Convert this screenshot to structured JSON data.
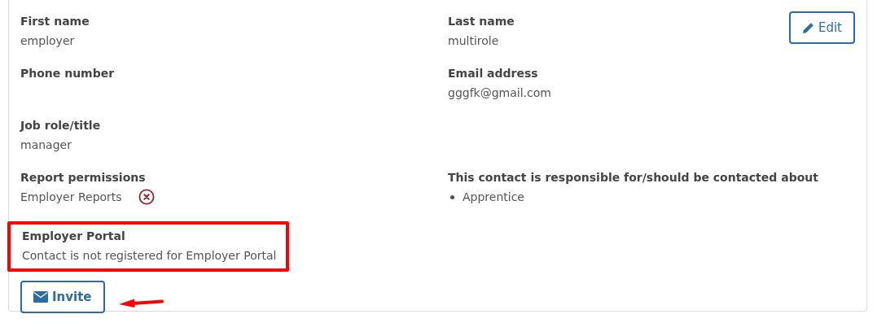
{
  "edit_button": {
    "label": "Edit"
  },
  "rows": [
    {
      "left": {
        "kind": "text",
        "label": "First name",
        "value": "employer"
      },
      "right": {
        "kind": "text",
        "label": "Last name",
        "value": "multirole"
      }
    },
    {
      "left": {
        "kind": "text",
        "label": "Phone number"
      },
      "right": {
        "kind": "text",
        "label": "Email address",
        "value": "gggfk@gmail.com"
      }
    },
    {
      "left": {
        "kind": "text",
        "label": "Job role/title",
        "value": "manager"
      }
    },
    {
      "left": {
        "kind": "removable",
        "label": "Report permissions",
        "value": "Employer Reports"
      },
      "right": {
        "kind": "list",
        "label": "This contact is responsible for/should be contacted about",
        "items": [
          "Apprentice"
        ]
      }
    }
  ],
  "portal": {
    "label": "Employer Portal",
    "value": "Contact is not registered for Employer Portal",
    "highlighted": true
  },
  "invite_button": {
    "label": "Invite"
  },
  "annotation_arrow": true
}
